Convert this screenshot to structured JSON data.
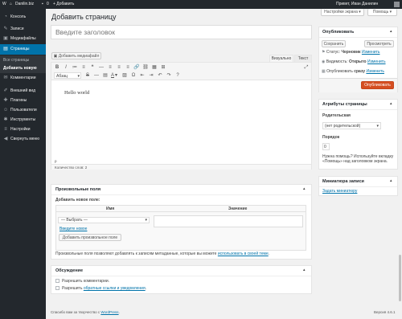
{
  "adminbar": {
    "wp_logo": "W",
    "site_name": "Danilin.biz",
    "comments_count": "0",
    "add_label": "+ Добавить",
    "greeting": "Привет, Иван Данилин"
  },
  "sidebar": {
    "items": [
      {
        "icon": "◔",
        "label": "Консоль"
      },
      {
        "icon": "✎",
        "label": "Записи"
      },
      {
        "icon": "▣",
        "label": "Медиафайлы"
      },
      {
        "icon": "▤",
        "label": "Страницы"
      },
      {
        "icon": "✉",
        "label": "Комментарии"
      },
      {
        "icon": "✐",
        "label": "Внешний вид"
      },
      {
        "icon": "✚",
        "label": "Плагины"
      },
      {
        "icon": "☺",
        "label": "Пользователи"
      },
      {
        "icon": "✱",
        "label": "Инструменты"
      },
      {
        "icon": "≡",
        "label": "Настройки"
      },
      {
        "icon": "◀",
        "label": "Свернуть меню"
      }
    ],
    "submenu": [
      "Все страницы",
      "Добавить новую"
    ]
  },
  "screen": {
    "options_label": "Настройки экрана ▾",
    "help_label": "Помощь ▾"
  },
  "page": {
    "title": "Добавить страницу",
    "title_placeholder": "Введите заголовок"
  },
  "editor": {
    "add_media": "Добавить медиафайл",
    "tab_visual": "Визуально",
    "tab_text": "Текст",
    "format_select": "Абзац",
    "content": "Hello world",
    "path": "p",
    "word_count": "Количество слов: 2",
    "toolbar1": [
      "B",
      "I",
      "≔",
      "≡",
      "❝",
      "—",
      "≡",
      "≡",
      "≡",
      "🔗",
      "⛓",
      "▦",
      "⊞"
    ],
    "toolbar2": [
      "S",
      "—",
      "▤",
      "A",
      "▾",
      "▨",
      "Ω",
      "⇤",
      "⇥",
      "↶",
      "↷",
      "?"
    ],
    "fullscreen": "⤢"
  },
  "custom_fields": {
    "title": "Произвольные поля",
    "add_new": "Добавить новое поле:",
    "col_name": "Имя",
    "col_value": "Значение",
    "select_value": "— Выбрать —",
    "enter_new": "Введите новое",
    "add_button": "Добавить произвольное поле",
    "help_text": "Произвольные поля позволяют добавлять к записям метаданные, которые вы можете",
    "help_link": "использовать в своей теме",
    "help_end": "."
  },
  "discussion": {
    "title": "Обсуждение",
    "allow_comments": "Разрешить комментарии.",
    "allow_pings_prefix": "Разрешить",
    "allow_pings_link": "обратные ссылки и уведомления",
    "allow_pings_suffix": "."
  },
  "publish": {
    "title": "Опубликовать",
    "save_button": "Сохранить",
    "preview_button": "Просмотреть",
    "status_label": "Статус:",
    "status_value": "Черновик",
    "visibility_label": "Видимость:",
    "visibility_value": "Открыто",
    "publish_label": "Опубликовать",
    "publish_value": "сразу",
    "edit_link": "Изменить",
    "publish_button": "Опубликовать"
  },
  "page_attributes": {
    "title": "Атрибуты страницы",
    "parent_label": "Родительская",
    "parent_value": "(нет родительской)",
    "order_label": "Порядок",
    "order_value": "0",
    "help_text": "Нужна помощь? Используйте вкладку «Помощь» над заголовком экрана."
  },
  "thumbnail": {
    "title": "Миниатюра записи",
    "set_link": "Задать миниатюру"
  },
  "footer": {
    "thanks_prefix": "Спасибо вам за творчество с",
    "thanks_link": "WordPress",
    "thanks_suffix": ".",
    "version": "Версия 4.6.1"
  },
  "colors": {
    "adminbar": "#23282d",
    "accent": "#0073aa",
    "publish": "#d54e21",
    "background": "#f1f1f1"
  }
}
